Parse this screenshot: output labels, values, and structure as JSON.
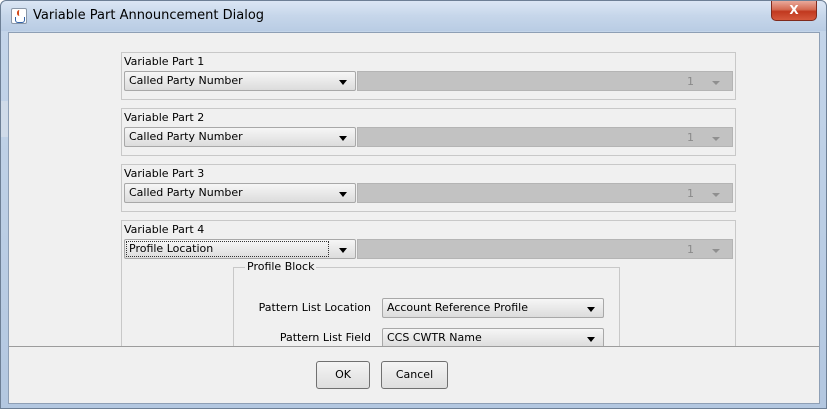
{
  "window": {
    "title": "Variable Part Announcement Dialog",
    "close_symbol": "X",
    "app_icon": "java-cup-icon",
    "close_color": "#c1381f"
  },
  "variable_parts": [
    {
      "label": "Variable Part 1",
      "selection": "Called Party Number",
      "number": "1"
    },
    {
      "label": "Variable Part 2",
      "selection": "Called Party Number",
      "number": "1"
    },
    {
      "label": "Variable Part 3",
      "selection": "Called Party Number",
      "number": "1"
    },
    {
      "label": "Variable Part 4",
      "selection": "Profile Location",
      "number": "1"
    }
  ],
  "profile_block": {
    "legend": "Profile Block",
    "pattern_list_location_label": "Pattern List Location",
    "pattern_list_location_value": "Account Reference Profile",
    "pattern_list_field_label": "Pattern List Field",
    "pattern_list_field_value": "CCS CWTR Name"
  },
  "buttons": {
    "ok": "OK",
    "cancel": "Cancel"
  }
}
